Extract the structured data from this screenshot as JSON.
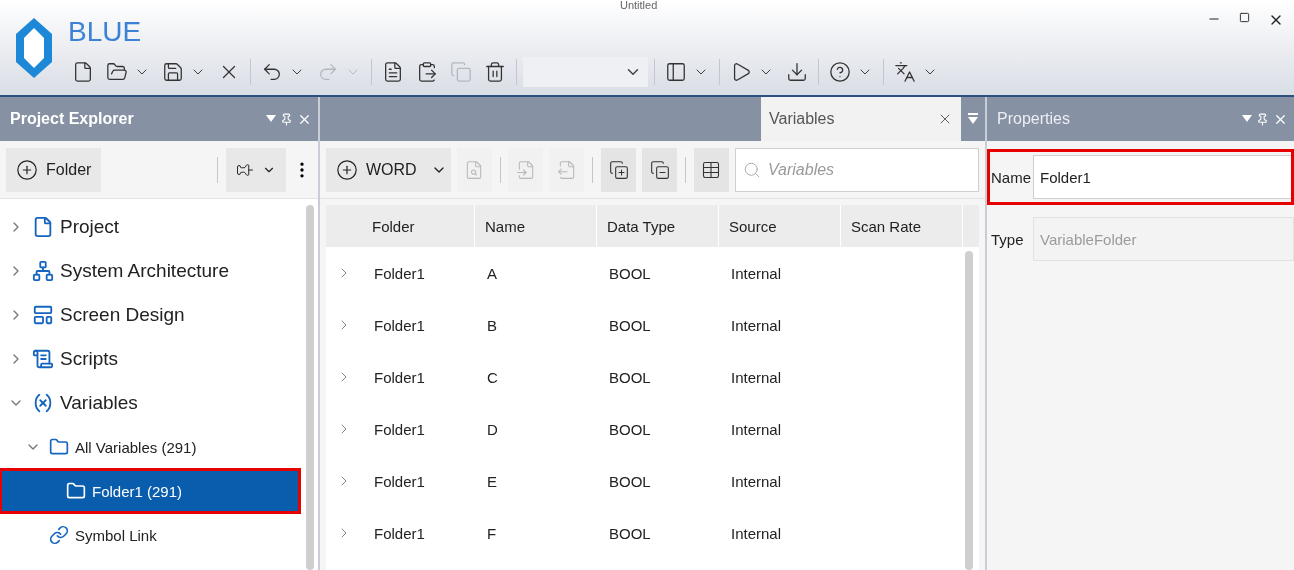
{
  "window": {
    "title": "Untitled",
    "app_name": "BLUE"
  },
  "toolbar": [
    {
      "kind": "button",
      "disabled": false,
      "dropdown": false
    },
    {
      "kind": "button",
      "disabled": false,
      "dropdown": true
    },
    {
      "kind": "button",
      "disabled": false,
      "dropdown": true
    },
    {
      "kind": "button",
      "disabled": false,
      "dropdown": false
    },
    {
      "kind": "separator"
    },
    {
      "kind": "button",
      "disabled": false,
      "dropdown": true
    },
    {
      "kind": "button",
      "disabled": true,
      "dropdown": true
    },
    {
      "kind": "separator"
    },
    {
      "kind": "button",
      "disabled": false,
      "dropdown": false
    },
    {
      "kind": "button",
      "disabled": false,
      "dropdown": false
    },
    {
      "kind": "button",
      "disabled": true,
      "dropdown": false
    },
    {
      "kind": "button",
      "disabled": false,
      "dropdown": false
    },
    {
      "kind": "separator"
    },
    {
      "kind": "combo"
    },
    {
      "kind": "separator"
    },
    {
      "kind": "button",
      "disabled": false,
      "dropdown": true
    },
    {
      "kind": "separator"
    },
    {
      "kind": "button",
      "disabled": false,
      "dropdown": true
    },
    {
      "kind": "button",
      "disabled": false,
      "dropdown": false
    },
    {
      "kind": "separator"
    },
    {
      "kind": "button",
      "disabled": false,
      "dropdown": true
    },
    {
      "kind": "separator"
    },
    {
      "kind": "button",
      "disabled": false,
      "dropdown": true
    }
  ],
  "explorer": {
    "title": "Project Explorer",
    "add_label": "Folder",
    "tree": [
      {
        "label": "Project",
        "kind": "document",
        "expanded": false,
        "selected": false,
        "highlighted": false
      },
      {
        "label": "System Architecture",
        "kind": "network",
        "expanded": false,
        "selected": false,
        "highlighted": false
      },
      {
        "label": "Screen Design",
        "kind": "screen",
        "expanded": false,
        "selected": false,
        "highlighted": false
      },
      {
        "label": "Scripts",
        "kind": "script",
        "expanded": false,
        "selected": false,
        "highlighted": false
      },
      {
        "label": "Variables",
        "kind": "variables",
        "expanded": true,
        "selected": false,
        "highlighted": false,
        "children": [
          {
            "label": "All Variables (291)",
            "kind": "folder",
            "expanded": true,
            "selected": false,
            "highlighted": false,
            "children": [
              {
                "label": "Folder1 (291)",
                "kind": "folder",
                "selected": true,
                "highlighted": true
              }
            ]
          },
          {
            "label": "Symbol Link",
            "kind": "link",
            "selected": false,
            "highlighted": false
          }
        ]
      }
    ]
  },
  "editor": {
    "tab": {
      "label": "Variables",
      "selected": true
    },
    "add_label": "WORD",
    "tools": [
      {
        "disabled": true
      },
      {
        "disabled": true
      },
      {
        "disabled": true
      },
      {
        "disabled": false
      },
      {
        "disabled": false
      },
      {
        "disabled": false
      }
    ],
    "search": {
      "placeholder": "Variables"
    },
    "columns": [
      "Folder",
      "Name",
      "Data Type",
      "Source",
      "Scan Rate"
    ],
    "rows": [
      [
        "Folder1",
        "A",
        "BOOL",
        "Internal"
      ],
      [
        "Folder1",
        "B",
        "BOOL",
        "Internal"
      ],
      [
        "Folder1",
        "C",
        "BOOL",
        "Internal"
      ],
      [
        "Folder1",
        "D",
        "BOOL",
        "Internal"
      ],
      [
        "Folder1",
        "E",
        "BOOL",
        "Internal"
      ],
      [
        "Folder1",
        "F",
        "BOOL",
        "Internal"
      ]
    ]
  },
  "properties": {
    "title": "Properties",
    "fields": [
      {
        "label": "Name",
        "value": "Folder1",
        "disabled": false,
        "highlighted": true
      },
      {
        "label": "Type",
        "value": "VariableFolder",
        "disabled": true,
        "highlighted": false
      }
    ]
  }
}
